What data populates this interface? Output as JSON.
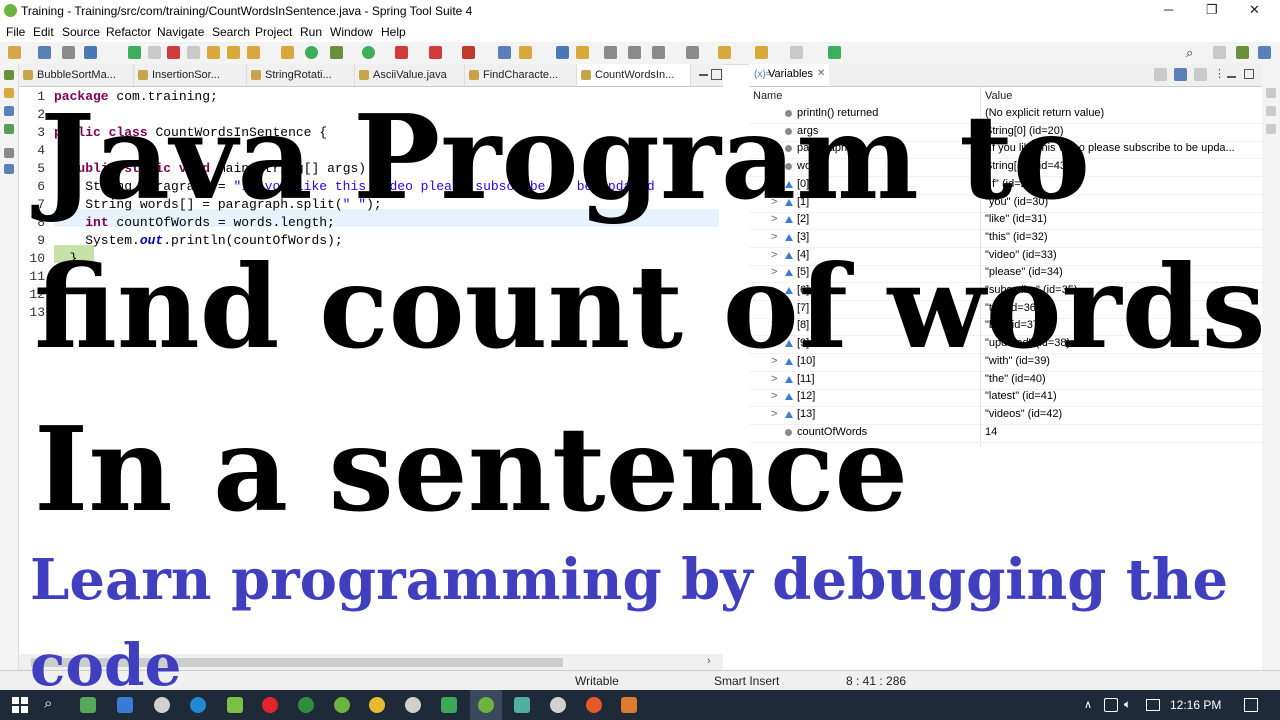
{
  "window": {
    "title": "Training - Training/src/com/training/CountWordsInSentence.java - Spring Tool Suite 4",
    "minimize": "─",
    "restore": "❐",
    "close": "✕"
  },
  "menu": [
    "File",
    "Edit",
    "Source",
    "Refactor",
    "Navigate",
    "Search",
    "Project",
    "Run",
    "Window",
    "Help"
  ],
  "editor": {
    "tabs": [
      "BubbleSortMa...",
      "InsertionSor...",
      "StringRotati...",
      "AsciiValue.java",
      "FindCharacte...",
      "CountWordsIn..."
    ],
    "active_tab": 5,
    "line_numbers": [
      "1",
      "2",
      "3",
      "4",
      "5",
      "6",
      "7",
      "8",
      "9",
      "10",
      "11",
      "12",
      "13"
    ],
    "code": {
      "l1_kw": "package",
      "l1_rest": " com.training;",
      "l3_kw1": "public",
      "l3_kw2": "class",
      "l3_rest": " CountWordsInSentence {",
      "l5_kw1": "public",
      "l5_kw2": "static",
      "l5_kw3": "void",
      "l5_rest": " main(String[] args) {",
      "l6_pre": "    String paragraph = ",
      "l6_str": "\"If you like this video please subscribe to be updated",
      "l7_pre": "    String words[] = paragraph.split(",
      "l7_str": "\" \"",
      "l7_post": ");",
      "l8_kw": "int",
      "l8_rest": " countOfWords = words.length;",
      "l9_pre": "    System.",
      "l9_fld": "out",
      "l9_post": ".println(countOfWords);",
      "l10": "  }"
    }
  },
  "variables": {
    "tab_label": "Variables",
    "col_name": "Name",
    "col_value": "Value",
    "rows": [
      {
        "expand": "",
        "name": "println() returned",
        "value": "(No explicit return value)"
      },
      {
        "expand": "",
        "name": "args",
        "value": "String[0]  (id=20)"
      },
      {
        "expand": ">",
        "name": "paragraph",
        "value": "\"If you like this video please subscribe to be upda..."
      },
      {
        "expand": "v",
        "name": "words",
        "value": "String[14]  (id=43)"
      },
      {
        "expand": ">",
        "name": "[0]",
        "value": "\"If\" (id=29)"
      },
      {
        "expand": ">",
        "name": "[1]",
        "value": "\"you\" (id=30)"
      },
      {
        "expand": ">",
        "name": "[2]",
        "value": "\"like\" (id=31)"
      },
      {
        "expand": ">",
        "name": "[3]",
        "value": "\"this\" (id=32)"
      },
      {
        "expand": ">",
        "name": "[4]",
        "value": "\"video\" (id=33)"
      },
      {
        "expand": ">",
        "name": "[5]",
        "value": "\"please\" (id=34)"
      },
      {
        "expand": ">",
        "name": "[6]",
        "value": "\"subscribe\" (id=35)"
      },
      {
        "expand": ">",
        "name": "[7]",
        "value": "\"to\" (id=36)"
      },
      {
        "expand": ">",
        "name": "[8]",
        "value": "\"be\" (id=37)"
      },
      {
        "expand": ">",
        "name": "[9]",
        "value": "\"updated\" (id=38)"
      },
      {
        "expand": ">",
        "name": "[10]",
        "value": "\"with\" (id=39)"
      },
      {
        "expand": ">",
        "name": "[11]",
        "value": "\"the\" (id=40)"
      },
      {
        "expand": ">",
        "name": "[12]",
        "value": "\"latest\" (id=41)"
      },
      {
        "expand": ">",
        "name": "[13]",
        "value": "\"videos\" (id=42)"
      },
      {
        "expand": "",
        "name": "countOfWords",
        "value": "14"
      }
    ]
  },
  "status": {
    "mode": "Writable",
    "insert": "Smart Insert",
    "position": "8 : 41 : 286"
  },
  "taskbar": {
    "clock": "12:16 PM"
  },
  "overlay": {
    "line1": "Java Program to",
    "line2": "find count of words",
    "line3": "In a sentence",
    "subtitle_line1": "Learn programming by debugging the",
    "subtitle_line2": "code",
    "title_color": "#000000",
    "subtitle_color": "#3f3fbf"
  }
}
